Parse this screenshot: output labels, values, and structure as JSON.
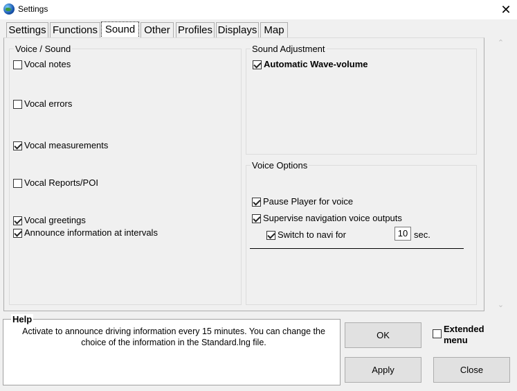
{
  "window": {
    "title": "Settings",
    "close_glyph": "✕"
  },
  "tabs": [
    {
      "label": "Settings"
    },
    {
      "label": "Functions"
    },
    {
      "label": "Sound",
      "active": true
    },
    {
      "label": "Other"
    },
    {
      "label": "Profiles"
    },
    {
      "label": "Displays"
    },
    {
      "label": "Map"
    }
  ],
  "voice_sound": {
    "label": "Voice / Sound",
    "items": [
      {
        "label": "Vocal notes",
        "checked": false
      },
      {
        "label": "Vocal errors",
        "checked": false
      },
      {
        "label": "Vocal measurements",
        "checked": true
      },
      {
        "label": "Vocal Reports/POI",
        "checked": false
      },
      {
        "label": "Vocal greetings",
        "checked": true
      },
      {
        "label": "Announce information at intervals",
        "checked": true
      }
    ]
  },
  "sound_adjustment": {
    "label": "Sound Adjustment",
    "items": [
      {
        "label": "Automatic Wave-volume",
        "checked": true
      }
    ]
  },
  "voice_options": {
    "label": "Voice Options",
    "items": [
      {
        "label": "Pause Player for voice",
        "checked": true
      },
      {
        "label": "Supervise navigation voice outputs",
        "checked": true
      },
      {
        "label": "Switch to navi for",
        "checked": true
      }
    ],
    "switch_value": "10",
    "switch_unit": "sec."
  },
  "scrollbar": {
    "up_arrow": "⌃",
    "down_arrow": "⌄"
  },
  "help": {
    "title": "Help",
    "text": "Activate to announce driving information every 15 minutes. You can change the choice of the information in the Standard.lng file."
  },
  "buttons": {
    "ok": "OK",
    "apply": "Apply",
    "close": "Close"
  },
  "extended_menu": {
    "label": "Extended menu",
    "checked": false
  }
}
